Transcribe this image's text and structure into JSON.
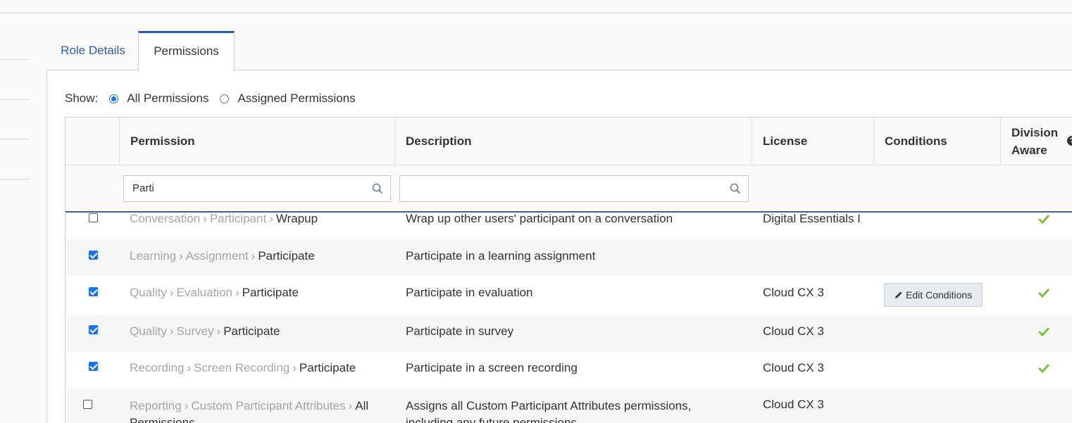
{
  "tabs": [
    {
      "label": "Role Details",
      "active": false
    },
    {
      "label": "Permissions",
      "active": true
    }
  ],
  "show_filter": {
    "label": "Show:",
    "options": [
      {
        "label": "All Permissions",
        "selected": true
      },
      {
        "label": "Assigned Permissions",
        "selected": false
      }
    ]
  },
  "table": {
    "columns": [
      "Permission",
      "Description",
      "License",
      "Conditions",
      "Division Aware"
    ],
    "division_col_line1": "Division",
    "division_col_line2": "Aware",
    "permission_filter_value": "Parti",
    "description_filter_value": "",
    "rows": [
      {
        "checked": false,
        "crumbs": [
          "Conversation",
          "Participant"
        ],
        "leaf": "Wrapup",
        "description": "Wrap up other users' participant on a conversation",
        "license": "Digital Essentials I",
        "conditions": "",
        "division_aware": true
      },
      {
        "checked": true,
        "crumbs": [
          "Learning",
          "Assignment"
        ],
        "leaf": "Participate",
        "description": "Participate in a learning assignment",
        "license": "",
        "conditions": "",
        "division_aware": false
      },
      {
        "checked": true,
        "crumbs": [
          "Quality",
          "Evaluation"
        ],
        "leaf": "Participate",
        "description": "Participate in evaluation",
        "license": "Cloud CX 3",
        "conditions": "Edit Conditions",
        "division_aware": true
      },
      {
        "checked": true,
        "crumbs": [
          "Quality",
          "Survey"
        ],
        "leaf": "Participate",
        "description": "Participate in survey",
        "license": "Cloud CX 3",
        "conditions": "",
        "division_aware": true
      },
      {
        "checked": true,
        "crumbs": [
          "Recording",
          "Screen Recording"
        ],
        "leaf": "Participate",
        "description": "Participate in a screen recording",
        "license": "Cloud CX 3",
        "conditions": "",
        "division_aware": true
      },
      {
        "checked": false,
        "crumbs": [
          "Reporting",
          "Custom Participant Attributes"
        ],
        "leaf": "All Permissions",
        "description": "Assigns all Custom Participant Attributes permissions, including any future permissions",
        "license": "Cloud CX 3",
        "conditions": "",
        "division_aware": false
      }
    ]
  },
  "colors": {
    "accent": "#2a5db0",
    "check": "#7cc242",
    "checkbox": "#1a73e8"
  }
}
